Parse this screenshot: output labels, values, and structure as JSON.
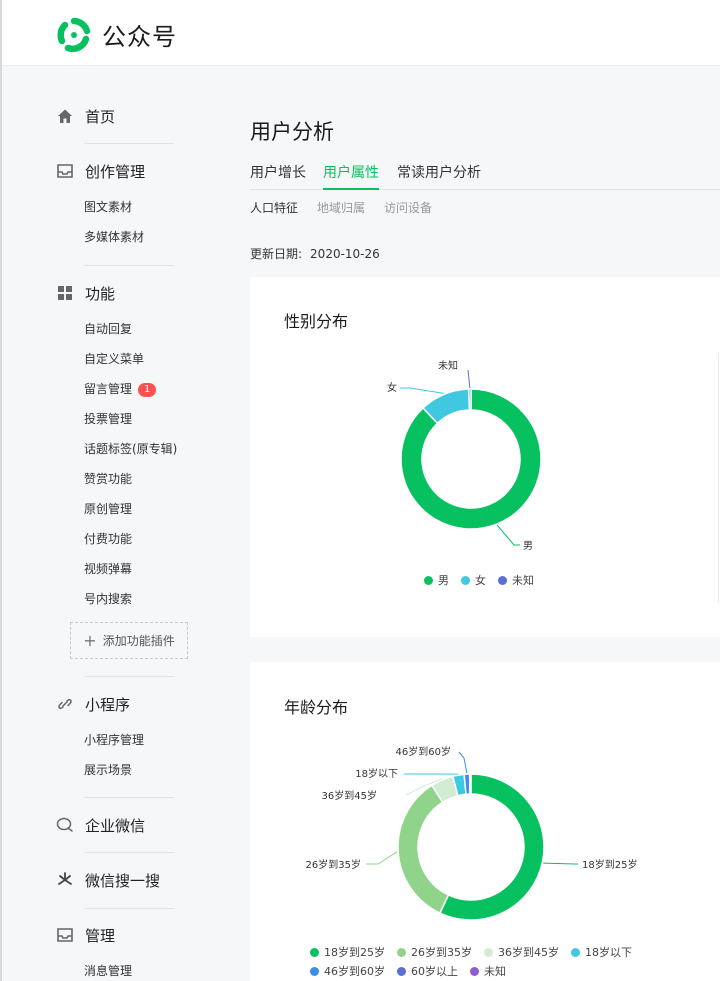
{
  "app": {
    "brand": "公众号"
  },
  "sidebar": {
    "home": {
      "label": "首页",
      "icon": "home-icon"
    },
    "creation": {
      "label": "创作管理",
      "icon": "inbox-icon",
      "items": [
        "图文素材",
        "多媒体素材"
      ]
    },
    "features": {
      "label": "功能",
      "icon": "grid-icon",
      "items": [
        "自动回复",
        "自定义菜单",
        "留言管理",
        "投票管理",
        "话题标签(原专辑)",
        "赞赏功能",
        "原创管理",
        "付费功能",
        "视频弹幕",
        "号内搜索"
      ],
      "badge": "1",
      "add_plugin": "添加功能插件"
    },
    "miniprogram": {
      "label": "小程序",
      "icon": "link-icon",
      "items": [
        "小程序管理",
        "展示场景"
      ]
    },
    "wecom": {
      "label": "企业微信",
      "icon": "chat-icon"
    },
    "search": {
      "label": "微信搜一搜",
      "icon": "sparkle-icon"
    },
    "manage": {
      "label": "管理",
      "icon": "inbox-icon",
      "items": [
        "消息管理"
      ]
    }
  },
  "main": {
    "title": "用户分析",
    "tabs": [
      "用户增长",
      "用户属性",
      "常读用户分析"
    ],
    "active_tab": "用户属性",
    "subtabs": [
      "人口特征",
      "地域归属",
      "访问设备"
    ],
    "active_subtab": "人口特征",
    "update_label": "更新日期:",
    "update_date": "2020-10-26"
  },
  "chart_data": [
    {
      "type": "pie",
      "title": "性别分布",
      "donut": true,
      "categories": [
        "男",
        "女",
        "未知"
      ],
      "values": [
        88,
        11.5,
        0.5
      ],
      "colors": [
        "#07c160",
        "#40c8e0",
        "#5b6fd0"
      ],
      "legend_placement": "bottom-center"
    },
    {
      "type": "pie",
      "title": "年龄分布",
      "donut": true,
      "categories": [
        "18岁到25岁",
        "26岁到35岁",
        "36岁到45岁",
        "18岁以下",
        "46岁到60岁",
        "60岁以上",
        "未知"
      ],
      "values": [
        57,
        34,
        5,
        2.5,
        1.2,
        0.2,
        0.1
      ],
      "colors": [
        "#07c160",
        "#8fd48a",
        "#d2ecd3",
        "#40c8e0",
        "#3b8ee8",
        "#5b6fd0",
        "#8e5cd0"
      ],
      "legend_placement": "bottom-center"
    }
  ]
}
